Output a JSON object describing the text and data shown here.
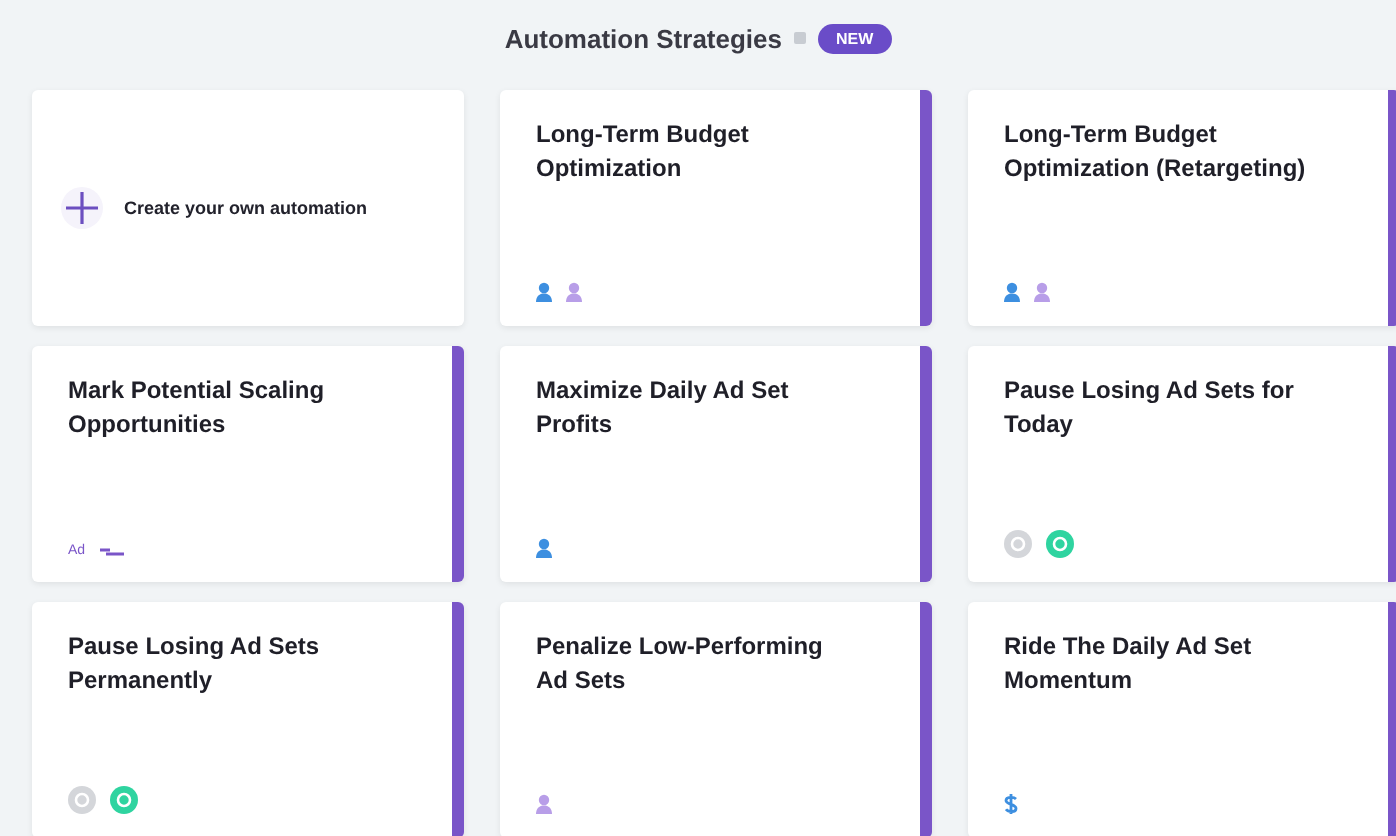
{
  "header": {
    "title": "Automation Strategies",
    "badge": "NEW"
  },
  "cards": [
    {
      "kind": "create",
      "title": "Create your own automation"
    },
    {
      "kind": "strategy",
      "title": "Long-Term Budget Optimization",
      "icons": [
        {
          "kind": "user",
          "color": "#3d8fe0"
        },
        {
          "kind": "user",
          "color": "#b89ee8"
        }
      ]
    },
    {
      "kind": "strategy",
      "title": "Long-Term Budget Optimization (Retargeting)",
      "icons": [
        {
          "kind": "user",
          "color": "#3d8fe0"
        },
        {
          "kind": "user",
          "color": "#b89ee8"
        }
      ]
    },
    {
      "kind": "strategy",
      "title": "Mark Potential Scaling Opportunities",
      "icons": [
        {
          "kind": "text",
          "label": "Ad"
        },
        {
          "kind": "tag",
          "color": "#7a55c8"
        }
      ]
    },
    {
      "kind": "strategy",
      "title": "Maximize Daily Ad Set Profits",
      "icons": [
        {
          "kind": "user",
          "color": "#3d8fe0"
        }
      ]
    },
    {
      "kind": "strategy",
      "title": "Pause Losing Ad Sets for Today",
      "icons": [
        {
          "kind": "circle",
          "color": "#d4d6da"
        },
        {
          "kind": "circle",
          "color": "#2fd4a0"
        }
      ]
    },
    {
      "kind": "strategy",
      "title": "Pause Losing Ad Sets Permanently",
      "icons": [
        {
          "kind": "circle",
          "color": "#d4d6da"
        },
        {
          "kind": "circle",
          "color": "#2fd4a0"
        }
      ]
    },
    {
      "kind": "strategy",
      "title": "Penalize Low-Performing Ad Sets",
      "icons": [
        {
          "kind": "user",
          "color": "#b89ee8"
        }
      ]
    },
    {
      "kind": "strategy",
      "title": "Ride The Daily Ad Set Momentum",
      "icons": [
        {
          "kind": "dollar",
          "color": "#3d8fe0"
        }
      ]
    }
  ]
}
